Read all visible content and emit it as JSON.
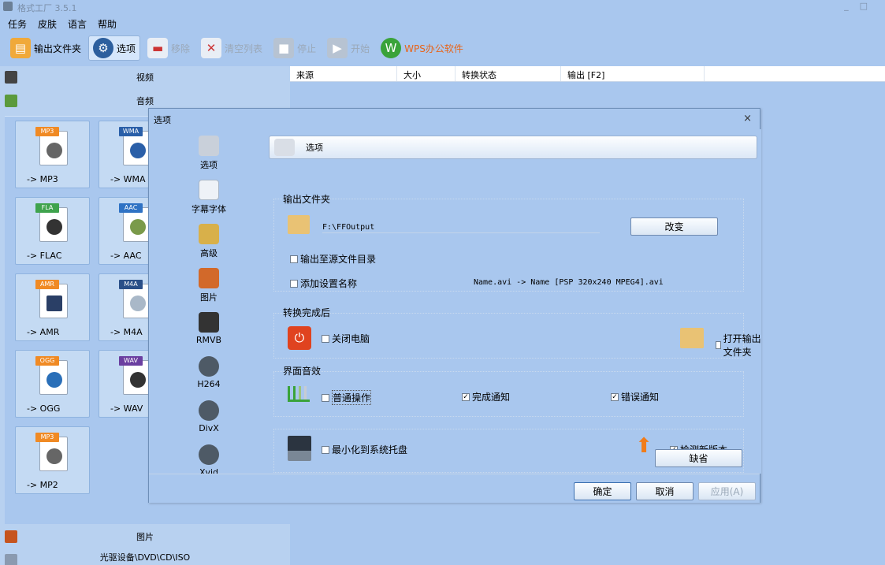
{
  "window": {
    "title": "格式工厂 3.5.1"
  },
  "menu": [
    "任务",
    "皮肤",
    "语言",
    "帮助"
  ],
  "toolbar": {
    "output_folder": "输出文件夹",
    "options": "选项",
    "remove": "移除",
    "clear_list": "清空列表",
    "stop": "停止",
    "start": "开始",
    "wps": "WPS办公软件"
  },
  "categories": {
    "video": "视频",
    "audio": "音频",
    "picture": "图片",
    "rom": "光驱设备\\DVD\\CD\\ISO"
  },
  "tiles": [
    {
      "tag": "MP3",
      "label": "-> MP3",
      "color": "#f08a24"
    },
    {
      "tag": "WMA",
      "label": "-> WMA",
      "color": "#2a5fa8"
    },
    {
      "tag": "FLA",
      "label": "-> FLAC",
      "color": "#3fa34d"
    },
    {
      "tag": "AAC",
      "label": "-> AAC",
      "color": "#2f72c4"
    },
    {
      "tag": "AMR",
      "label": "-> AMR",
      "color": "#f08a24"
    },
    {
      "tag": "M4A",
      "label": "-> M4A",
      "color": "#2a4f88"
    },
    {
      "tag": "OGG",
      "label": "-> OGG",
      "color": "#f08a24"
    },
    {
      "tag": "WAV",
      "label": "-> WAV",
      "color": "#6b3fa0"
    },
    {
      "tag": "MP3",
      "label": "-> MP2",
      "color": "#f08a24"
    }
  ],
  "filelist": {
    "columns": [
      "来源",
      "大小",
      "转换状态",
      "输出 [F2]"
    ]
  },
  "dialog": {
    "title": "选项",
    "close": "×",
    "sidebar": [
      "选项",
      "字幕字体",
      "高级",
      "图片",
      "RMVB",
      "H264",
      "DivX",
      "Xvid"
    ],
    "header": "选项",
    "output_section": "输出文件夹",
    "output_path": "F:\\FFOutput",
    "change": "改变",
    "output_to_source": "输出至源文件目录",
    "add_setting_name": "添加设置名称",
    "name_example": "Name.avi  -> Name [PSP 320x240 MPEG4].avi",
    "after_section": "转换完成后",
    "shutdown": "关闭电脑",
    "open_output": "打开输出文件夹",
    "sound_section": "界面音效",
    "normal_op": "普通操作",
    "done_notify": "完成通知",
    "error_notify": "错误通知",
    "minimize_tray": "最小化到系统托盘",
    "check_update": "检测新版本",
    "default": "缺省",
    "ok": "确定",
    "cancel": "取消",
    "apply": "应用(A)"
  }
}
